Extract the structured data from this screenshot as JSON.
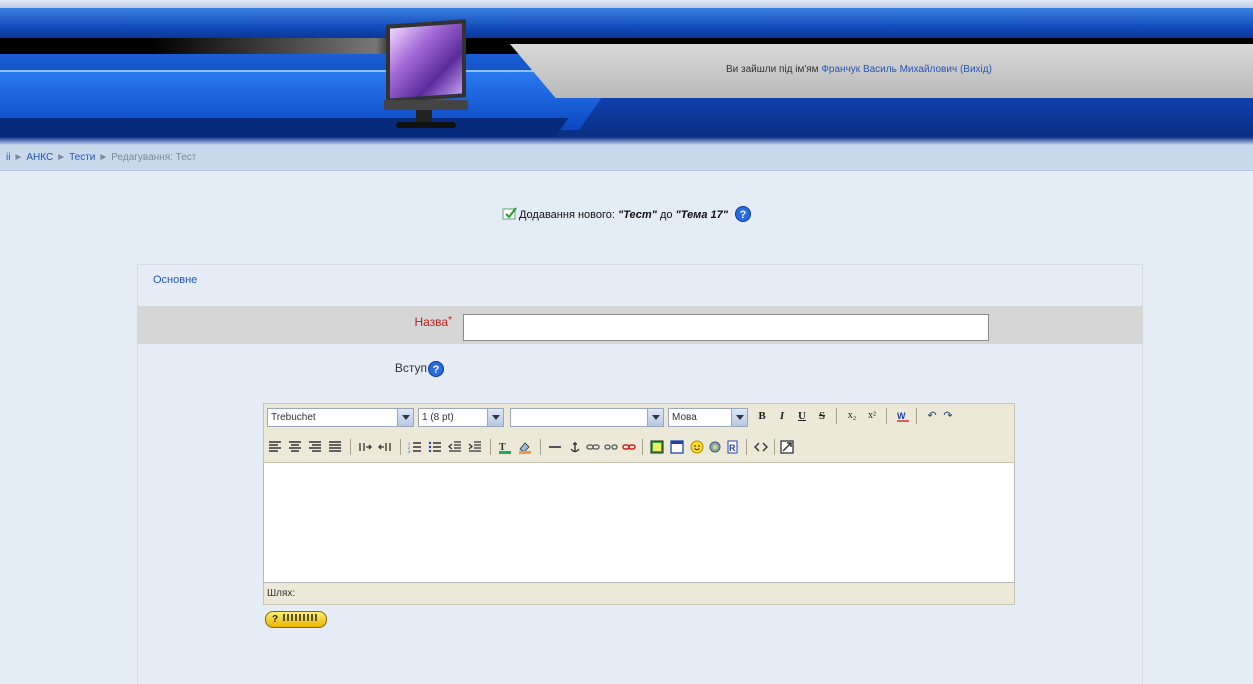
{
  "header": {
    "login_prefix": "Ви зайшли під ім'ям",
    "user_name": "Франчук Василь Михайлович",
    "logout": "(Вихід)"
  },
  "breadcrumb": {
    "home": "ii",
    "items": [
      "АНКС",
      "Тести",
      "Редагування: Тест"
    ]
  },
  "page": {
    "heading_prefix": "Додавання нового: ",
    "heading_type": "\"Тест\"",
    "heading_mid": " до ",
    "heading_target": "\"Тема 17\""
  },
  "form": {
    "section_legend": "Основне",
    "name_label": "Назва",
    "name_required": "*",
    "name_value": "",
    "intro_label": "Вступ"
  },
  "editor": {
    "font_family": "Trebuchet",
    "font_size": "1 (8 pt)",
    "format": "",
    "language": "Мова",
    "path_label": "Шлях:",
    "buttons_row1": [
      "B",
      "I",
      "U",
      "S",
      "x₂",
      "x²"
    ],
    "undo": "↶",
    "redo": "↷"
  },
  "help_button": "?",
  "colors": {
    "link": "#2457b8",
    "required": "#e00000",
    "page_bg": "#e4ecf6"
  }
}
